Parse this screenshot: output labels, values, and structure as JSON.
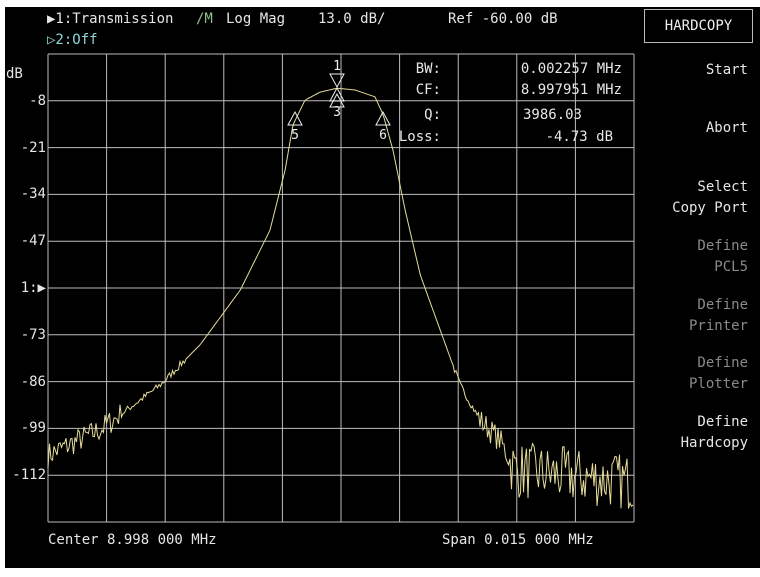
{
  "header": {
    "channel1": "▶1:Transmission",
    "format_prefix": "/M",
    "format": "Log Mag",
    "scale": "13.0 dB/",
    "ref": "Ref -60.00 dB",
    "channel2": "▷2:Off"
  },
  "y_axis": {
    "unit": "dB",
    "ticks": [
      "-8",
      "-21",
      "-34",
      "-47",
      "1:▶",
      "-73",
      "-86",
      "-99",
      "-112"
    ]
  },
  "markers_readout": [
    {
      "label": "BW:",
      "value": "0.002257 MHz"
    },
    {
      "label": "CF:",
      "value": "8.997951 MHz"
    },
    {
      "label": "Q:",
      "value": "3986.03"
    },
    {
      "label": "Loss:",
      "value": "-4.73 dB"
    }
  ],
  "markers": [
    "1",
    "3",
    "5",
    "6"
  ],
  "footer": {
    "center": "Center 8.998 000 MHz",
    "span": "Span 0.015 000 MHz"
  },
  "softkeys": {
    "title": "HARDCOPY",
    "items": [
      {
        "label": "Start",
        "enabled": true
      },
      {
        "label": "Abort",
        "enabled": true
      },
      {
        "label": "Select\nCopy Port",
        "enabled": true
      },
      {
        "label": "Define\nPCL5",
        "enabled": false
      },
      {
        "label": "Define\nPrinter",
        "enabled": false
      },
      {
        "label": "Define\nPlotter",
        "enabled": false
      },
      {
        "label": "Define\nHardcopy",
        "enabled": true
      }
    ]
  },
  "trace": {
    "color": "#e6dc9a",
    "ref_db": -60,
    "db_per_div": 13,
    "center_mhz": 8.998,
    "span_mhz": 0.015,
    "points_mhz_db": [
      [
        8.9905,
        -106.4
      ],
      [
        8.99183,
        -99.4
      ],
      [
        8.99337,
        -87
      ],
      [
        8.99439,
        -75.8
      ],
      [
        8.99542,
        -60.6
      ],
      [
        8.99618,
        -44
      ],
      [
        8.99657,
        -27.2
      ],
      [
        8.99677,
        -14.7
      ],
      [
        8.99708,
        -7.8
      ],
      [
        8.99746,
        -5.6
      ],
      [
        8.9979,
        -4.5
      ],
      [
        8.99836,
        -5
      ],
      [
        8.99887,
        -6.9
      ],
      [
        8.99908,
        -11.9
      ],
      [
        8.99933,
        -21.7
      ],
      [
        8.99964,
        -38.3
      ],
      [
        9.00003,
        -56.4
      ],
      [
        9.00054,
        -71.7
      ],
      [
        9.00105,
        -87
      ],
      [
        9.00156,
        -96.7
      ],
      [
        9.00207,
        -102.3
      ],
      [
        9.00245,
        -110.6
      ],
      [
        9.0055,
        -114
      ]
    ]
  }
}
